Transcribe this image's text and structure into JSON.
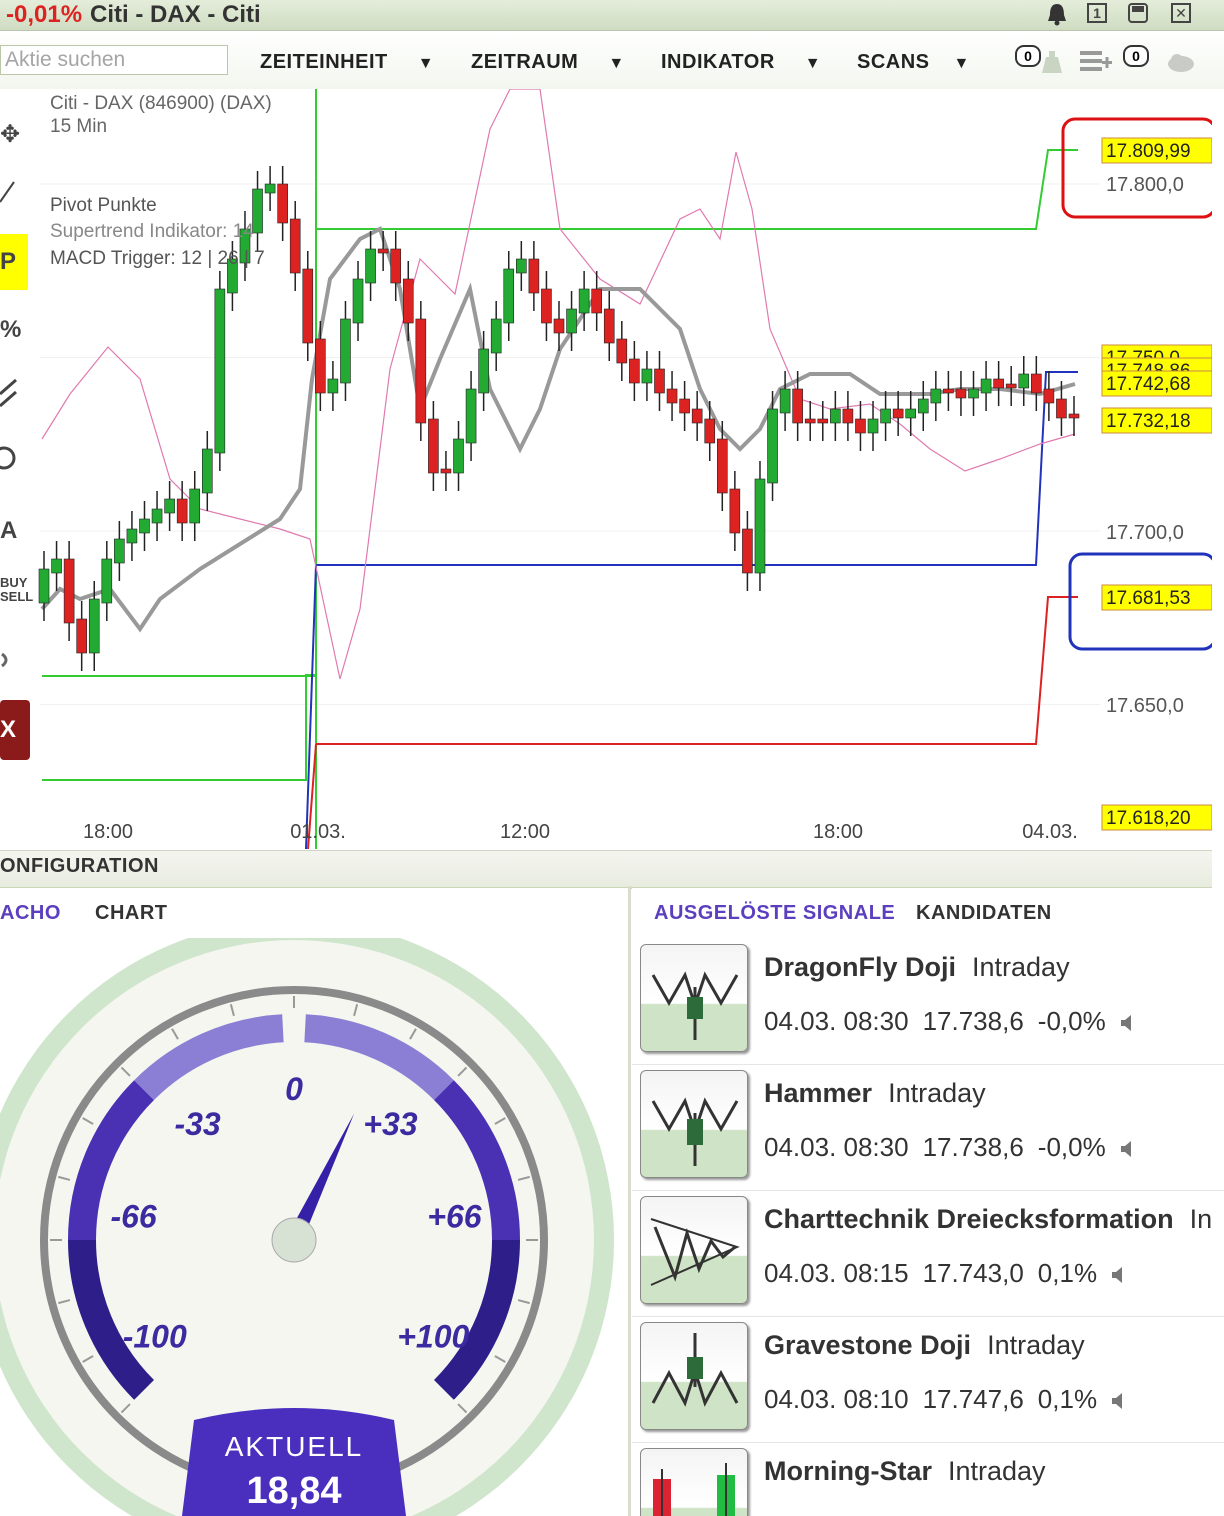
{
  "window": {
    "change": "-0,01%",
    "title": "Citi - DAX - Citi",
    "icons": [
      "bell-icon",
      "window-1-icon",
      "window-2-icon",
      "close-icon"
    ]
  },
  "toolbar": {
    "search_placeholder": "Aktie suchen",
    "menus": [
      "ZEITEINHEIT",
      "ZEITRAUM",
      "INDIKATOR",
      "SCANS"
    ],
    "badge_left": "0",
    "badge_right": "0"
  },
  "chart": {
    "instrument": "Citi - DAX (846900) (DAX)",
    "interval": "15 Min",
    "indicators": [
      "Pivot Punkte",
      "Supertrend Indikator: 14",
      "MACD Trigger: 12 | 26 | 7"
    ],
    "x_ticks": [
      "18:00",
      "01.03.",
      "12:00",
      "18:00",
      "04.03."
    ],
    "y_ticks": [
      "17.800,0",
      "17.700,0",
      "17.650,0"
    ],
    "price_labels": [
      "17.809,99",
      "17.750,0",
      "17.748,86",
      "17.742,68",
      "17.732,18",
      "17.681,53",
      "17.618,20"
    ],
    "tools": [
      "move-icon",
      "line-icon",
      "P",
      "%",
      "lines-icon",
      "circle-icon",
      "A",
      "BUY SELL",
      "sound-icon",
      "X"
    ]
  },
  "config": {
    "label": "ONFIGURATION"
  },
  "tacho": {
    "tabs": [
      "ACHO",
      "CHART"
    ],
    "scale": [
      "0",
      "-33",
      "+33",
      "-66",
      "+66",
      "-100",
      "+100"
    ],
    "current_label": "AKTUELL",
    "current_value": "18,84",
    "value": 18.84
  },
  "signals": {
    "tabs": [
      "AUSGELÖSTE SIGNALE",
      "KANDIDATEN"
    ],
    "items": [
      {
        "name": "DragonFly Doji",
        "type": "Intraday",
        "time": "04.03. 08:30",
        "price": "17.738,6",
        "change": "-0,0%"
      },
      {
        "name": "Hammer",
        "type": "Intraday",
        "time": "04.03. 08:30",
        "price": "17.738,6",
        "change": "-0,0%"
      },
      {
        "name": "Charttechnik Dreiecksformation",
        "type": "In",
        "time": "04.03. 08:15",
        "price": "17.743,0",
        "change": "0,1%"
      },
      {
        "name": "Gravestone Doji",
        "type": "Intraday",
        "time": "04.03. 08:10",
        "price": "17.747,6",
        "change": "0,1%"
      },
      {
        "name": "Morning-Star",
        "type": "Intraday",
        "time": "",
        "price": "",
        "change": ""
      }
    ]
  },
  "colors": {
    "up": "#22aa33",
    "down": "#dd2222",
    "pivot_green": "#33cc33",
    "pivot_blue": "#2233bb",
    "pivot_red": "#dd2222",
    "supertrend": "#999999",
    "macd": "#e07ab0",
    "label_bg": "#ffff00",
    "tacho_purple": "#5b3fbf"
  }
}
